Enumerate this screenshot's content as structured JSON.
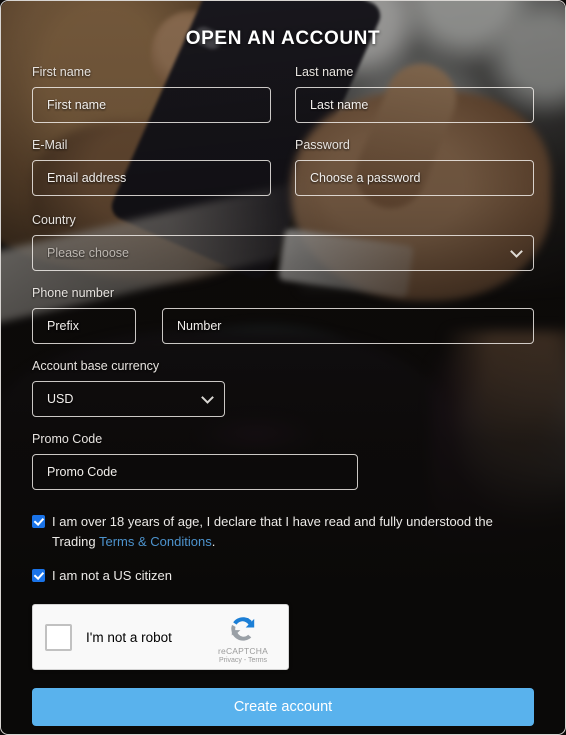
{
  "form": {
    "title": "OPEN AN ACCOUNT",
    "first_name": {
      "label": "First name",
      "placeholder": "First name",
      "value": ""
    },
    "last_name": {
      "label": "Last name",
      "placeholder": "Last name",
      "value": ""
    },
    "email": {
      "label": "E-Mail",
      "placeholder": "Email address",
      "value": ""
    },
    "password": {
      "label": "Password",
      "placeholder": "Choose a password",
      "value": ""
    },
    "country": {
      "label": "Country",
      "placeholder": "Please choose",
      "selected": "Please choose",
      "chevron_icon": "chevron-down-icon"
    },
    "phone": {
      "label": "Phone number",
      "prefix_placeholder": "Prefix",
      "prefix_value": "",
      "number_placeholder": "Number",
      "number_value": ""
    },
    "currency": {
      "label": "Account base currency",
      "selected": "USD",
      "chevron_icon": "chevron-down-icon"
    },
    "promo": {
      "label": "Promo Code",
      "placeholder": "Promo Code",
      "value": ""
    },
    "consent_age": {
      "checked": true,
      "text_before": "I am over 18 years of age, I declare that I have read and fully understood the Trading ",
      "link_text": "Terms & Conditions",
      "text_after": "."
    },
    "consent_us": {
      "checked": true,
      "text": "I am not a US citizen"
    },
    "recaptcha": {
      "label": "I'm not a robot",
      "brand": "reCAPTCHA",
      "legal": "Privacy - Terms",
      "logo_icon": "recaptcha-logo-icon",
      "checkbox_checked": false
    },
    "submit_label": "Create account"
  },
  "colors": {
    "accent_button": "#59b2ed",
    "link": "#4d93cd",
    "checkbox": "#1a73e8",
    "page_background": "#100d0c",
    "field_border": "#f5f2ee",
    "text": "#ffffff"
  }
}
